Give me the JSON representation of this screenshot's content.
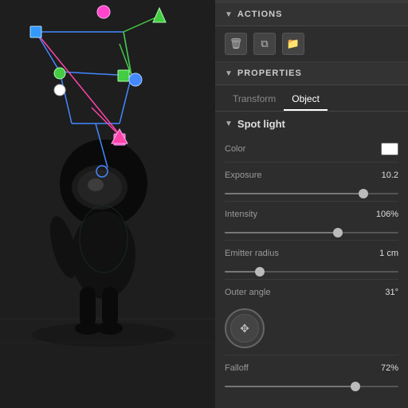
{
  "viewport": {
    "background": "#1e1e1e"
  },
  "panel": {
    "top_indicator": "...",
    "actions": {
      "title": "ACTIONS",
      "buttons": [
        {
          "label": "🗑",
          "name": "delete-button"
        },
        {
          "label": "⧉",
          "name": "duplicate-button"
        },
        {
          "label": "📁",
          "name": "folder-button"
        }
      ]
    },
    "properties": {
      "title": "PROPERTIES",
      "tabs": [
        {
          "label": "Transform",
          "active": false
        },
        {
          "label": "Object",
          "active": true
        }
      ],
      "spotlight": {
        "title": "Spot light",
        "properties": [
          {
            "label": "Color",
            "type": "color",
            "value": "#ffffff",
            "display_value": ""
          },
          {
            "label": "Exposure",
            "type": "slider",
            "value": "10.2",
            "slider_percent": 80
          },
          {
            "label": "Intensity",
            "type": "slider",
            "value": "106%",
            "slider_percent": 65
          },
          {
            "label": "Emitter radius",
            "type": "slider",
            "value": "1 cm",
            "slider_percent": 20
          },
          {
            "label": "Outer angle",
            "type": "dial",
            "value": "31°",
            "slider_percent": 0
          },
          {
            "label": "Falloff",
            "type": "slider",
            "value": "72%",
            "slider_percent": 75
          }
        ]
      }
    }
  }
}
